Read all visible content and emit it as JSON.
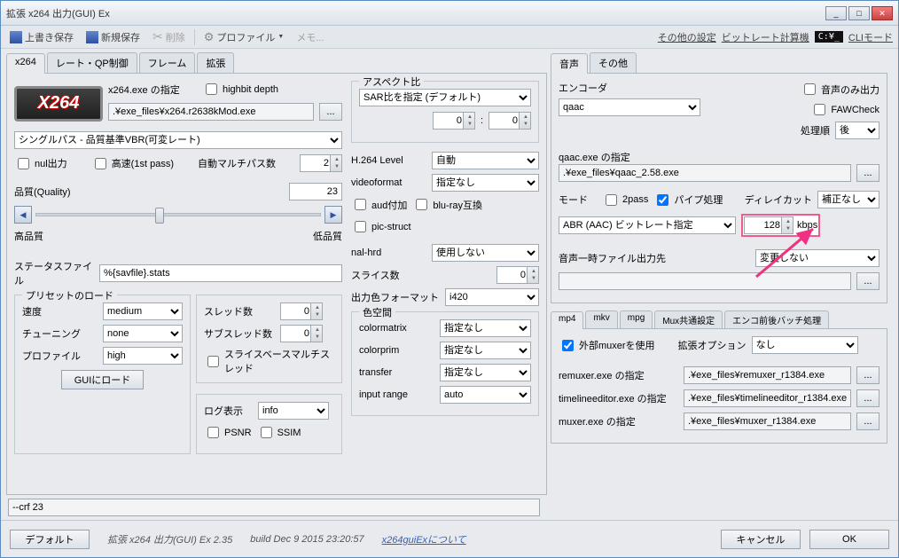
{
  "window_title": "拡張 x264 出力(GUI) Ex",
  "toolbar": {
    "save_over": "上書き保存",
    "save_new": "新規保存",
    "delete": "削除",
    "profile": "プロファイル",
    "memo": "メモ...",
    "other_settings": "その他の設定",
    "bitrate_calc": "ビットレート計算機",
    "cli_mode": "CLIモード"
  },
  "main_tabs": [
    "x264",
    "レート・QP制御",
    "フレーム",
    "拡張"
  ],
  "x264": {
    "exe_label": "x264.exe の指定",
    "highbit": "highbit depth",
    "exe_path": ".¥exe_files¥x264.r2638kMod.exe",
    "mode": "シングルパス - 品質基準VBR(可変レート)",
    "nul_out": "nul出力",
    "fast1st": "高速(1st pass)",
    "auto_multi_label": "自動マルチパス数",
    "auto_multi_val": "2",
    "quality_label": "品質(Quality)",
    "quality_val": "23",
    "hq_label": "高品質",
    "lq_label": "低品質",
    "stats_label": "ステータスファイル",
    "stats_val": "%{savfile}.stats",
    "preset_group": "プリセットのロード",
    "speed_label": "速度",
    "speed_val": "medium",
    "tuning_label": "チューニング",
    "tuning_val": "none",
    "profile_label": "プロファイル",
    "profile_val": "high",
    "gui_load": "GUIにロード",
    "threads_label": "スレッド数",
    "threads_val": "0",
    "subthreads_label": "サブスレッド数",
    "subthreads_val": "0",
    "slicemt": "スライスベースマルチスレッド",
    "log_label": "ログ表示",
    "log_val": "info",
    "psnr": "PSNR",
    "ssim": "SSIM",
    "aspect_group": "アスペクト比",
    "aspect_mode": "SAR比を指定 (デフォルト)",
    "sar_w": "0",
    "sar_h": "0",
    "h264level_label": "H.264 Level",
    "h264level_val": "自動",
    "videoformat_label": "videoformat",
    "videoformat_val": "指定なし",
    "aud": "aud付加",
    "bluray": "blu-ray互換",
    "picstruct": "pic-struct",
    "nalhrd_label": "nal-hrd",
    "nalhrd_val": "使用しない",
    "slice_label": "スライス数",
    "slice_val": "0",
    "outfmt_label": "出力色フォーマット",
    "outfmt_val": "i420",
    "colorspace_group": "色空間",
    "colormatrix_label": "colormatrix",
    "colormatrix_val": "指定なし",
    "colorprim_label": "colorprim",
    "colorprim_val": "指定なし",
    "transfer_label": "transfer",
    "transfer_val": "指定なし",
    "inputrange_label": "input range",
    "inputrange_val": "auto"
  },
  "audio_tabs": [
    "音声",
    "その他"
  ],
  "audio": {
    "encoder_label": "エンコーダ",
    "encoder_val": "qaac",
    "audio_only": "音声のみ出力",
    "fawcheck": "FAWCheck",
    "order_label": "処理順",
    "order_val": "後",
    "exe_label": "qaac.exe の指定",
    "exe_path": ".¥exe_files¥qaac_2.58.exe",
    "mode_label": "モード",
    "twopass": "2pass",
    "pipe": "パイプ処理",
    "delay_label": "ディレイカット",
    "delay_val": "補正なし",
    "rate_mode": "ABR (AAC) ビットレート指定",
    "bitrate": "128",
    "kbps": "kbps",
    "temp_label": "音声一時ファイル出力先",
    "temp_val": "変更しない",
    "temp_path": ""
  },
  "mux_tabs": [
    "mp4",
    "mkv",
    "mpg",
    "Mux共通設定",
    "エンコ前後バッチ処理"
  ],
  "mux": {
    "ext_muxer": "外部muxerを使用",
    "ext_opt_label": "拡張オプション",
    "ext_opt_val": "なし",
    "remuxer_label": "remuxer.exe の指定",
    "remuxer_path": ".¥exe_files¥remuxer_r1384.exe",
    "tl_label": "timelineeditor.exe の指定",
    "tl_path": ".¥exe_files¥timelineeditor_r1384.exe",
    "muxer_label": "muxer.exe の指定",
    "muxer_path": ".¥exe_files¥muxer_r1384.exe"
  },
  "status_crf": "--crf 23",
  "footer": {
    "default": "デフォルト",
    "app": "拡張 x264 出力(GUI) Ex 2.35",
    "build": "build Dec  9 2015 23:20:57",
    "about": "x264guiExについて",
    "cancel": "キャンセル",
    "ok": "OK"
  }
}
